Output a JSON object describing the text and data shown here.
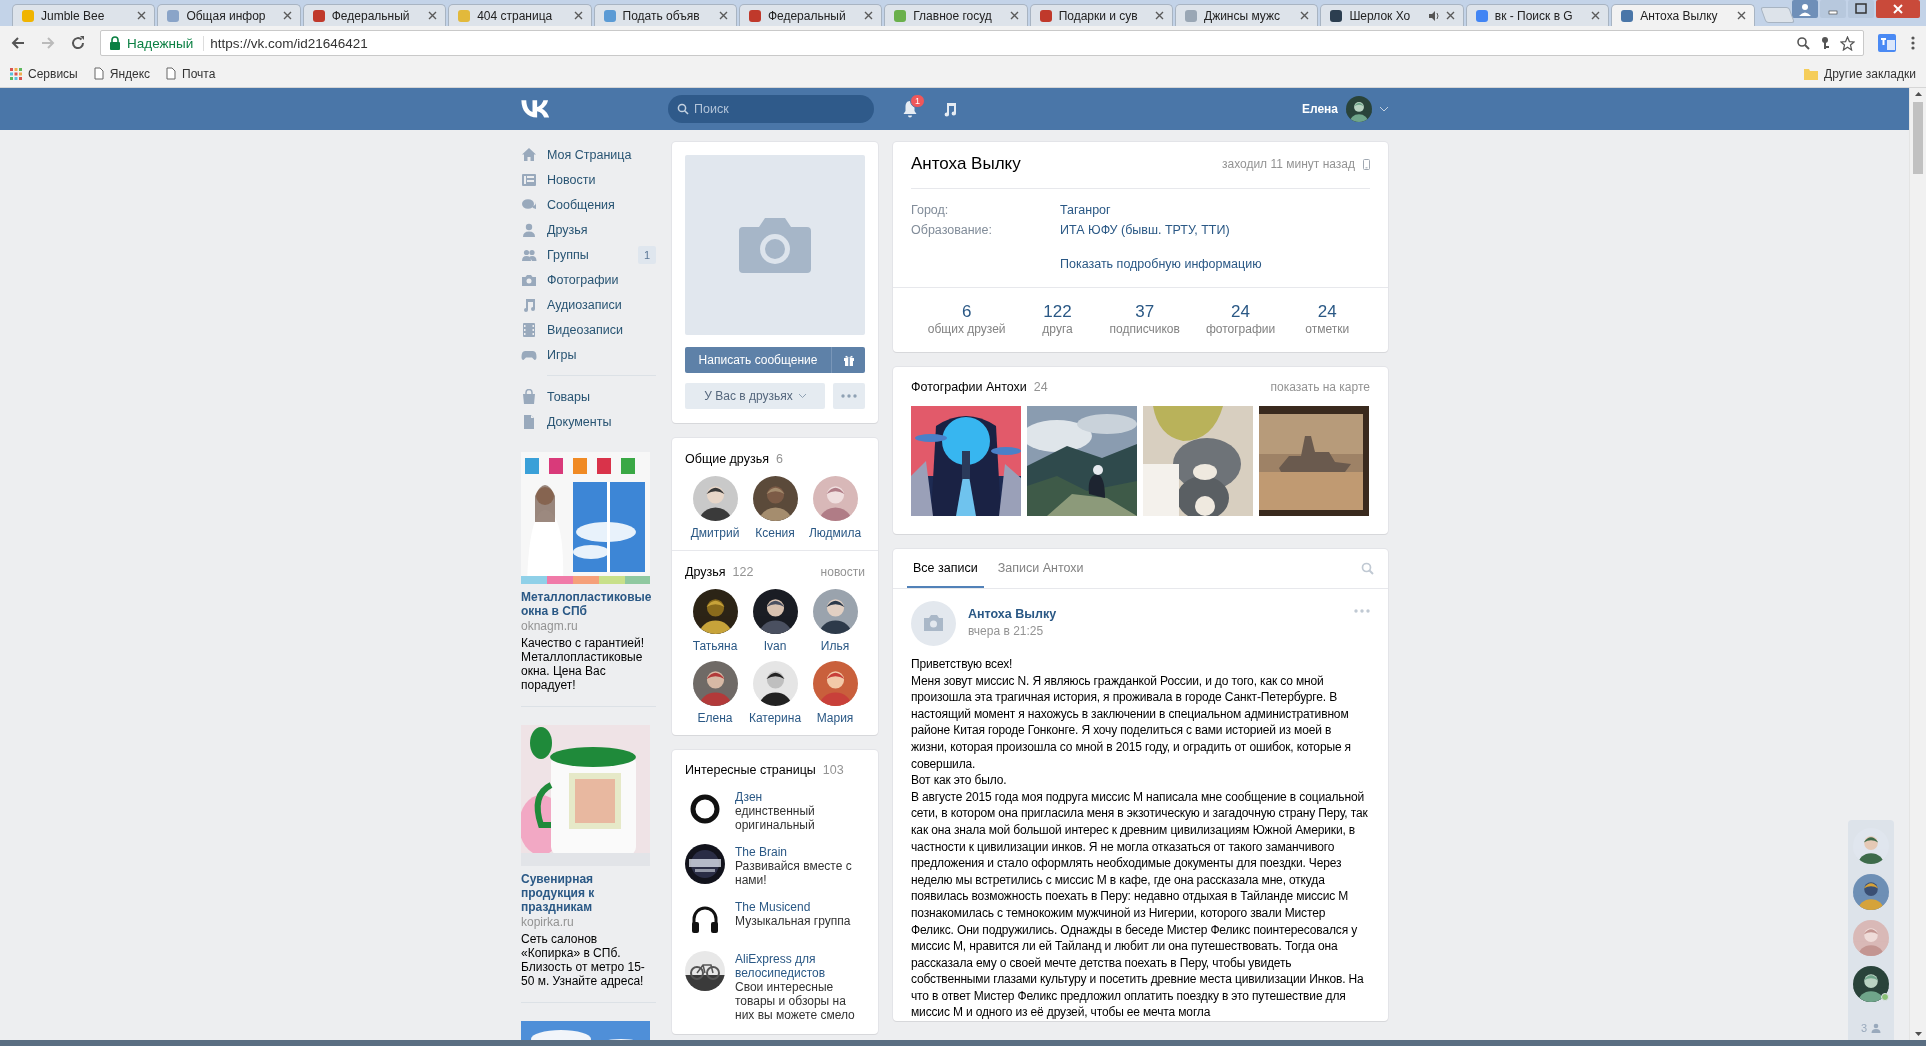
{
  "browser": {
    "tabs": [
      {
        "title": "Jumble Bee",
        "selected": false,
        "playing_audio": false
      },
      {
        "title": "Общая инфор",
        "selected": false,
        "playing_audio": false
      },
      {
        "title": "Федеральный",
        "selected": false,
        "playing_audio": false
      },
      {
        "title": "404 страница",
        "selected": false,
        "playing_audio": false
      },
      {
        "title": "Подать объяв",
        "selected": false,
        "playing_audio": false
      },
      {
        "title": "Федеральный",
        "selected": false,
        "playing_audio": false
      },
      {
        "title": "Главное госуд",
        "selected": false,
        "playing_audio": false
      },
      {
        "title": "Подарки и сув",
        "selected": false,
        "playing_audio": false
      },
      {
        "title": "Джинсы мужс",
        "selected": false,
        "playing_audio": false
      },
      {
        "title": "Шерлок Хо",
        "selected": false,
        "playing_audio": true
      },
      {
        "title": "вк - Поиск в G",
        "selected": false,
        "playing_audio": false
      },
      {
        "title": "Антоха Вылку",
        "selected": true,
        "playing_audio": false
      }
    ],
    "address": {
      "security": "Надежный",
      "url": "https://vk.com/id21646421"
    },
    "bookmarks": [
      "Сервисы",
      "Яндекс",
      "Почта"
    ],
    "other_bookmarks": "Другие закладки"
  },
  "header": {
    "search": {
      "placeholder": "Поиск"
    },
    "notification_count": "1",
    "user": "Елена"
  },
  "nav": {
    "items": [
      {
        "label": "Моя Страница"
      },
      {
        "label": "Новости"
      },
      {
        "label": "Сообщения"
      },
      {
        "label": "Друзья"
      },
      {
        "label": "Группы",
        "badge": "1"
      },
      {
        "label": "Фотографии"
      },
      {
        "label": "Аудиозаписи"
      },
      {
        "label": "Видеозаписи"
      },
      {
        "label": "Игры"
      }
    ],
    "more_items": [
      {
        "label": "Товары"
      },
      {
        "label": "Документы"
      }
    ]
  },
  "ads": [
    {
      "kind": "picture",
      "title": "Металлопластиковые окна в СПб",
      "domain": "oknagm.ru",
      "text": "Качество с гарантией! Металлопластиковые окна. Цена Вас порадует!"
    },
    {
      "kind": "picture",
      "title": "Сувенирная продукция к праздникам",
      "domain": "kopirka.ru",
      "text": "Сеть салонов «Копирка» в СПб. Близость от метро 15-50 м. Узнайте адреса!"
    },
    {
      "kind": "picture"
    }
  ],
  "actions": {
    "message_button": "Написать сообщение",
    "friend_status": "У Вас в друзьях"
  },
  "common_friends": {
    "title": "Общие друзья",
    "count": "6",
    "people": [
      {
        "name": "Дмитрий"
      },
      {
        "name": "Ксения"
      },
      {
        "name": "Людмила"
      }
    ]
  },
  "friends": {
    "title": "Друзья",
    "count": "122",
    "link": "новости",
    "people": [
      {
        "name": "Татьяна"
      },
      {
        "name": "Ivan"
      },
      {
        "name": "Илья"
      },
      {
        "name": "Елена"
      },
      {
        "name": "Катерина"
      },
      {
        "name": "Мария"
      }
    ]
  },
  "pages": {
    "title": "Интересные страницы",
    "count": "103",
    "items": [
      {
        "kind": "ring",
        "name": "Дзен",
        "description": "единственный оригинальный"
      },
      {
        "kind": "picture",
        "name": "The Brain",
        "description": "Развивайся вместе с нами!"
      },
      {
        "kind": "headphones",
        "name": "The Musicend",
        "description": "Музыкальная группа"
      },
      {
        "kind": "picture",
        "name": "AliExpress для велосипедистов",
        "description": "Свои интересные товары и обзоры на них вы можете смело"
      }
    ]
  },
  "info": {
    "name": "Антоха Вылку",
    "last_seen": "заходил 11 минут назад",
    "fields": [
      {
        "label": "Город:",
        "value": "Таганрог"
      },
      {
        "label": "Образование:",
        "value": "ИТА ЮФУ (бывш. ТРТУ, ТТИ)"
      }
    ],
    "more_link": "Показать подробную информацию",
    "counters": [
      {
        "value": "6",
        "label": "общих друзей"
      },
      {
        "value": "122",
        "label": "друга"
      },
      {
        "value": "37",
        "label": "подписчиков"
      },
      {
        "value": "24",
        "label": "фотографии"
      },
      {
        "value": "24",
        "label": "отметки"
      }
    ]
  },
  "photos": {
    "title": "Фотографии Антохи",
    "count": "24",
    "map_link": "показать на карте",
    "items": [
      {
        "kind": "picture"
      },
      {
        "kind": "picture"
      },
      {
        "kind": "picture"
      },
      {
        "kind": "picture"
      }
    ]
  },
  "wall": {
    "tabs": [
      {
        "label": "Все записи",
        "selected": true
      },
      {
        "label": "Записи Антохи",
        "selected": false
      }
    ],
    "post": {
      "author": "Антоха Вылку",
      "time": "вчера в 21:25",
      "paragraphs": [
        "Приветствую всех!",
        "Меня зовут миссис N. Я являюсь гражданкой России, и до того, как со мной произошла эта трагичная история, я проживала в городе Санкт-Петербурге. В настоящий момент я нахожусь в заключении в специальном административном районе Китая городе Гонконге. Я хочу поделиться с вами историей из моей в жизни, которая произошла со мной в 2015 году, и оградить от ошибок, которые я совершила.",
        "Вот как это было.",
        "В августе 2015 года моя подруга миссис М написала мне сообщение в социальной сети, в котором она пригласила меня в экзотическую и загадочную страну Перу, так как она знала мой большой интерес к древним цивилизациям Южной Америки, в частности к цивилизации инков. Я не могла отказаться от такого заманчивого предложения и стало оформлять необходимые документы для поездки. Через неделю мы встретились с миссис М в кафе, где она рассказала мне, откуда появилась возможность поехать в Перу: недавно отдыхая в Тайланде миссис М познакомилась с темнокожим мужчиной из Нигерии, которого звали Мистер Феликс. Они подружились. Однажды в беседе Мистер Феликс поинтересовался у миссис М, нравится ли ей Тайланд и любит ли она путешествовать. Тогда она рассказала ему о своей мечте детства поехать в Перу, чтобы увидеть собственными глазами культуру и посетить древние места цивилизации Инков. На что в ответ Мистер Феликс предложил оплатить поездку в это путешествие для миссис М и одного из её друзей, чтобы ее мечта могла"
      ]
    }
  },
  "chat_panel": {
    "contacts": [
      {
        "online": false
      },
      {
        "online": false
      },
      {
        "online": false
      },
      {
        "online": true
      }
    ],
    "online_count": "3"
  }
}
